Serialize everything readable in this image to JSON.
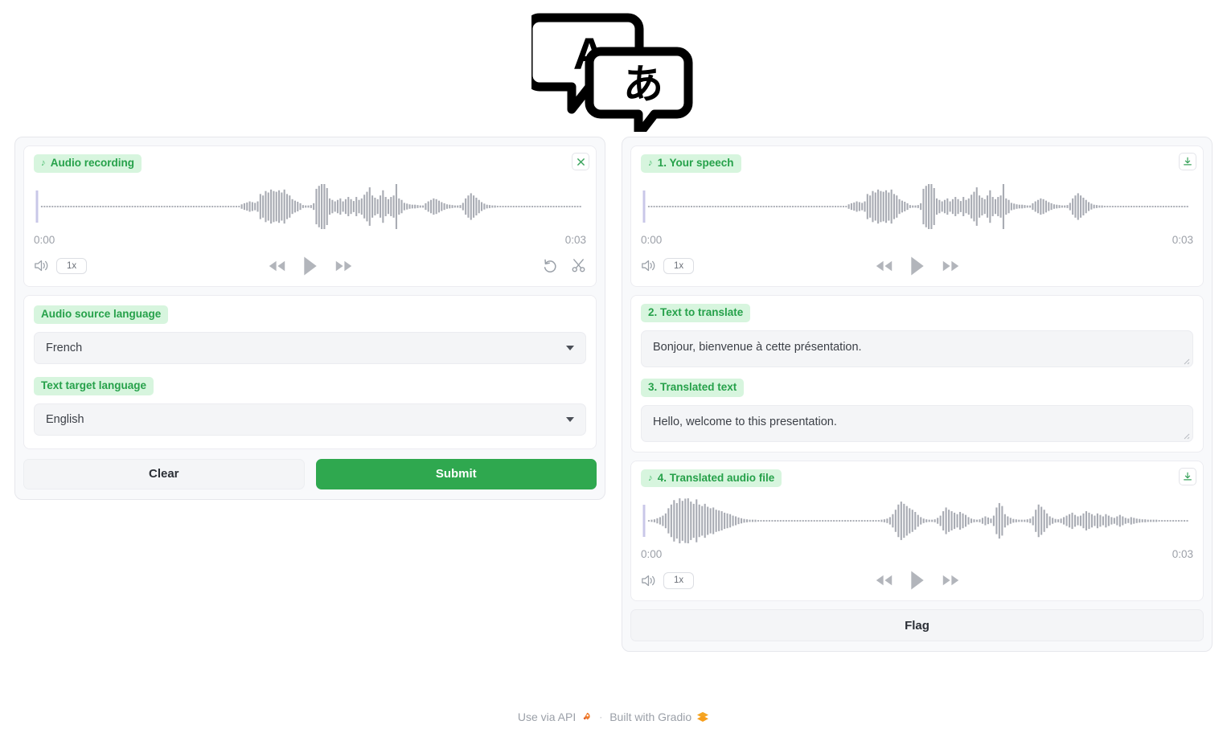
{
  "app": {
    "logo_alt": "translate-speech-bubbles-logo",
    "logo_left_glyph": "A",
    "logo_right_glyph": "あ"
  },
  "input_panel": {
    "recorder": {
      "label": "Audio recording",
      "label_icon": "music-note-icon",
      "clear_icon": "close-icon",
      "time_start": "0:00",
      "time_end": "0:03",
      "speed": "1x",
      "volume_icon": "volume-icon",
      "rewind_icon": "rewind-icon",
      "play_icon": "play-icon",
      "forward_icon": "fast-forward-icon",
      "undo_icon": "undo-icon",
      "trim_icon": "scissors-icon"
    },
    "source_language": {
      "label": "Audio source language",
      "value": "French",
      "caret_icon": "chevron-down-icon"
    },
    "target_language": {
      "label": "Text target language",
      "value": "English",
      "caret_icon": "chevron-down-icon"
    },
    "clear_button": "Clear",
    "submit_button": "Submit"
  },
  "output_panel": {
    "speech": {
      "label": "1. Your speech",
      "label_icon": "music-note-icon",
      "download_icon": "download-icon",
      "time_start": "0:00",
      "time_end": "0:03",
      "speed": "1x",
      "volume_icon": "volume-icon",
      "rewind_icon": "rewind-icon",
      "play_icon": "play-icon",
      "forward_icon": "fast-forward-icon"
    },
    "text_to_translate": {
      "label": "2. Text to translate",
      "value": "Bonjour, bienvenue à cette présentation."
    },
    "translated_text": {
      "label": "3. Translated text",
      "value": "Hello, welcome to this presentation."
    },
    "translated_audio": {
      "label": "4. Translated audio file",
      "label_icon": "music-note-icon",
      "download_icon": "download-icon",
      "time_start": "0:00",
      "time_end": "0:03",
      "speed": "1x",
      "volume_icon": "volume-icon",
      "rewind_icon": "rewind-icon",
      "play_icon": "play-icon",
      "forward_icon": "fast-forward-icon"
    },
    "flag_button": "Flag"
  },
  "footer": {
    "api_label": "Use via API",
    "api_icon": "rocket-icon",
    "separator": "·",
    "gradio_label": "Built with Gradio",
    "gradio_icon": "gradio-logo-icon"
  },
  "colors": {
    "accent_green": "#2fa84f",
    "chip_bg": "#d7f5de",
    "chip_text": "#26a14a",
    "panel_bg": "#f8f9fb",
    "field_bg": "#f4f5f7",
    "waveform_bar": "#a8abb3",
    "playhead": "#c9c7e8"
  },
  "waveforms": {
    "input": [
      2,
      2,
      2,
      2,
      2,
      2,
      2,
      2,
      2,
      2,
      2,
      2,
      2,
      2,
      2,
      2,
      2,
      2,
      2,
      2,
      2,
      2,
      2,
      2,
      2,
      2,
      2,
      2,
      2,
      2,
      2,
      2,
      2,
      2,
      2,
      2,
      2,
      2,
      2,
      2,
      2,
      2,
      2,
      2,
      2,
      2,
      2,
      2,
      2,
      2,
      2,
      2,
      2,
      2,
      2,
      2,
      2,
      2,
      2,
      2,
      2,
      2,
      2,
      2,
      2,
      2,
      2,
      2,
      2,
      2,
      2,
      2,
      2,
      2,
      2,
      6,
      9,
      11,
      14,
      12,
      10,
      14,
      34,
      30,
      42,
      38,
      46,
      42,
      40,
      44,
      38,
      46,
      34,
      30,
      20,
      16,
      13,
      9,
      4,
      3,
      3,
      4,
      9,
      48,
      56,
      66,
      74,
      50,
      22,
      18,
      14,
      18,
      22,
      14,
      20,
      26,
      20,
      15,
      26,
      18,
      22,
      32,
      40,
      52,
      30,
      24,
      20,
      30,
      44,
      26,
      20,
      26,
      30,
      62,
      22,
      18,
      10,
      8,
      6,
      5,
      5,
      4,
      3,
      3,
      9,
      14,
      18,
      22,
      20,
      16,
      12,
      9,
      6,
      5,
      4,
      3,
      3,
      4,
      10,
      22,
      30,
      36,
      30,
      24,
      18,
      12,
      8,
      5,
      4,
      3,
      3,
      2,
      2,
      2,
      2,
      2,
      2,
      2,
      2,
      2,
      2,
      2,
      2,
      2,
      2,
      2,
      2,
      2,
      2,
      2,
      2,
      2,
      2,
      2,
      2,
      2,
      2,
      2,
      2,
      2,
      2,
      2,
      2
    ],
    "output": [
      2,
      3,
      4,
      7,
      10,
      14,
      20,
      34,
      44,
      56,
      48,
      62,
      54,
      60,
      66,
      52,
      46,
      58,
      44,
      40,
      46,
      38,
      34,
      36,
      30,
      28,
      26,
      22,
      20,
      18,
      14,
      12,
      9,
      7,
      5,
      4,
      3,
      3,
      3,
      2,
      2,
      2,
      2,
      2,
      2,
      2,
      2,
      2,
      2,
      2,
      2,
      2,
      2,
      2,
      2,
      2,
      2,
      2,
      2,
      2,
      2,
      2,
      2,
      2,
      2,
      2,
      2,
      2,
      2,
      2,
      2,
      2,
      2,
      2,
      2,
      2,
      2,
      2,
      2,
      2,
      2,
      2,
      2,
      3,
      4,
      6,
      10,
      18,
      30,
      44,
      52,
      46,
      40,
      34,
      30,
      24,
      16,
      10,
      6,
      4,
      3,
      3,
      4,
      8,
      14,
      26,
      36,
      30,
      26,
      22,
      18,
      24,
      20,
      16,
      10,
      6,
      4,
      3,
      4,
      8,
      12,
      9,
      6,
      14,
      36,
      48,
      40,
      18,
      12,
      8,
      5,
      4,
      3,
      3,
      3,
      4,
      6,
      12,
      30,
      44,
      38,
      30,
      20,
      12,
      8,
      5,
      4,
      6,
      10,
      14,
      18,
      22,
      16,
      12,
      14,
      20,
      26,
      22,
      18,
      14,
      20,
      16,
      12,
      18,
      14,
      10,
      8,
      12,
      16,
      12,
      8,
      6,
      10,
      8,
      6,
      5,
      4,
      4,
      3,
      3,
      3,
      3,
      2,
      2,
      2,
      2,
      2,
      2,
      2,
      2,
      2,
      2,
      2
    ]
  }
}
